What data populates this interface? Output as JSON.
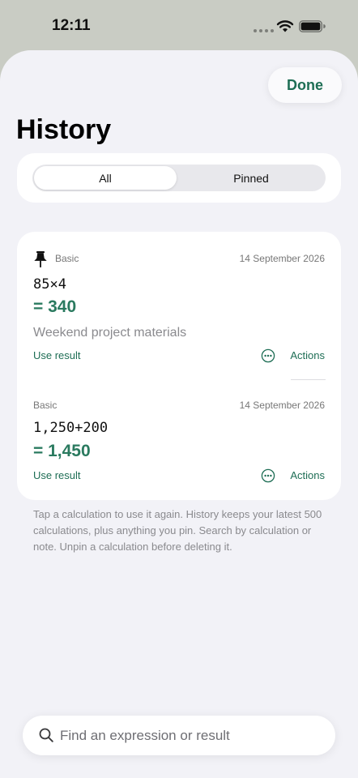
{
  "status_bar": {
    "time": "12:11"
  },
  "header": {
    "done_label": "Done",
    "title": "History"
  },
  "segments": {
    "all": "All",
    "pinned": "Pinned"
  },
  "entries": [
    {
      "pinned": true,
      "mode": "Basic",
      "date": "14 September 2026",
      "expression": "85×4",
      "result": "= 340",
      "note": "Weekend project materials",
      "use_result": "Use result",
      "actions": "Actions"
    },
    {
      "pinned": false,
      "mode": "Basic",
      "date": "14 September 2026",
      "expression": "1,250+200",
      "result": "= 1,450",
      "note": "",
      "use_result": "Use result",
      "actions": "Actions"
    }
  ],
  "footer_note": "Tap a calculation to use it again. History keeps your latest 500 calculations, plus anything you pin. Search by calculation or note. Unpin a calculation before deleting it.",
  "search": {
    "placeholder": "Find an expression or result"
  },
  "colors": {
    "accent": "#1e6e55",
    "result": "#2a7a5f",
    "sheet_bg": "#f2f2f7"
  }
}
